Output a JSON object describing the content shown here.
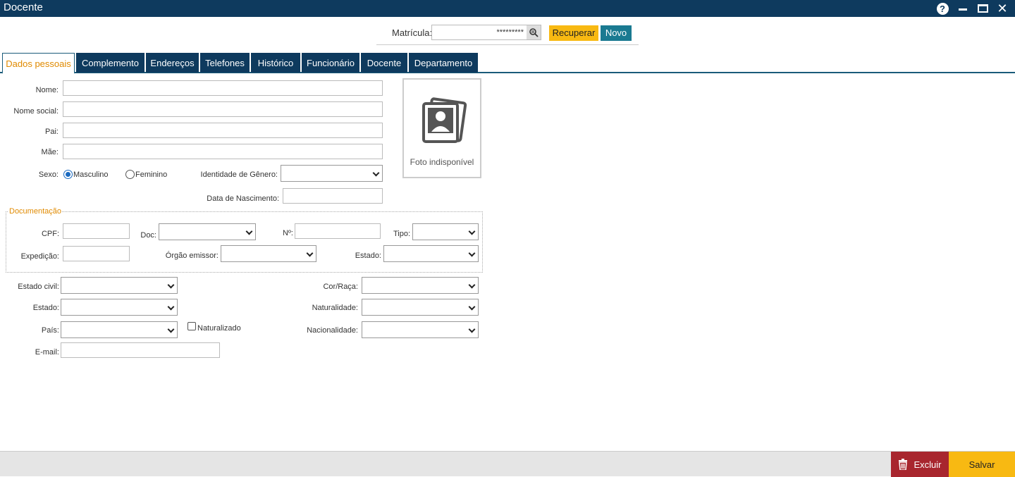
{
  "window": {
    "title": "Docente",
    "help_glyph": "?",
    "close_glyph": "✕"
  },
  "matricula": {
    "label": "Matrícula:",
    "value": "*********",
    "recuperar_label": "Recuperar",
    "novo_label": "Novo"
  },
  "tabs": [
    "Dados pessoais",
    "Complemento",
    "Endereços",
    "Telefones",
    "Histórico",
    "Funcionário",
    "Docente",
    "Departamento"
  ],
  "personal": {
    "nome_label": "Nome:",
    "nome_social_label": "Nome social:",
    "pai_label": "Pai:",
    "mae_label": "Mãe:",
    "sexo_label": "Sexo:",
    "masculino_label": "Masculino",
    "feminino_label": "Feminino",
    "sexo_selected": "Masculino",
    "identidade_label": "Identidade de Gênero:",
    "nascimento_label": "Data de Nascimento:",
    "photo_caption": "Foto indisponível"
  },
  "documentacao": {
    "legend": "Documentação",
    "cpf_label": "CPF:",
    "doc_label": "Doc:",
    "numero_label": "Nº:",
    "tipo_label": "Tipo:",
    "expedicao_label": "Expedição:",
    "orgao_label": "Órgão emissor:",
    "estado_label": "Estado:"
  },
  "extra": {
    "estado_civil_label": "Estado civil:",
    "estado_label": "Estado:",
    "pais_label": "País:",
    "naturalizado_label": "Naturalizado",
    "email_label": "E-mail:",
    "cor_raca_label": "Cor/Raça:",
    "naturalidade_label": "Naturalidade:",
    "nacionalidade_label": "Nacionalidade:"
  },
  "footer": {
    "excluir_label": "Excluir",
    "salvar_label": "Salvar"
  },
  "colors": {
    "header": "#0e3a5e",
    "accent_orange": "#e08a00",
    "yellow": "#f8b912",
    "teal": "#1a7a91",
    "delete_red": "#a8262e"
  }
}
